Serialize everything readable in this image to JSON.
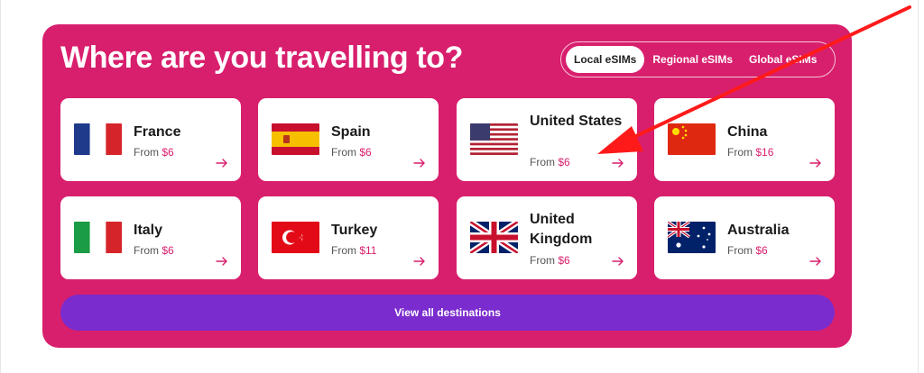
{
  "header": {
    "title": "Where are you travelling to?"
  },
  "tabs": [
    {
      "label": "Local eSIMs",
      "active": true
    },
    {
      "label": "Regional eSIMs",
      "active": false
    },
    {
      "label": "Global eSIMs",
      "active": false
    }
  ],
  "destinations": [
    {
      "name": "France",
      "price_prefix": "From",
      "price": "$6",
      "flag": "france-flag-icon"
    },
    {
      "name": "Spain",
      "price_prefix": "From",
      "price": "$6",
      "flag": "spain-flag-icon"
    },
    {
      "name": "United States",
      "price_prefix": "From",
      "price": "$6",
      "flag": "usa-flag-icon"
    },
    {
      "name": "China",
      "price_prefix": "From",
      "price": "$16",
      "flag": "china-flag-icon"
    },
    {
      "name": "Italy",
      "price_prefix": "From",
      "price": "$6",
      "flag": "italy-flag-icon"
    },
    {
      "name": "Turkey",
      "price_prefix": "From",
      "price": "$11",
      "flag": "turkey-flag-icon"
    },
    {
      "name": "United Kingdom",
      "price_prefix": "From",
      "price": "$6",
      "flag": "uk-flag-icon"
    },
    {
      "name": "Australia",
      "price_prefix": "From",
      "price": "$6",
      "flag": "australia-flag-icon"
    }
  ],
  "cta": {
    "label": "View all destinations"
  },
  "colors": {
    "panel": "#d81f6d",
    "cta": "#7a2cce",
    "annotation_arrow": "#ff1a1a"
  },
  "annotation": {
    "icon": "red-pointer-arrow-icon"
  }
}
